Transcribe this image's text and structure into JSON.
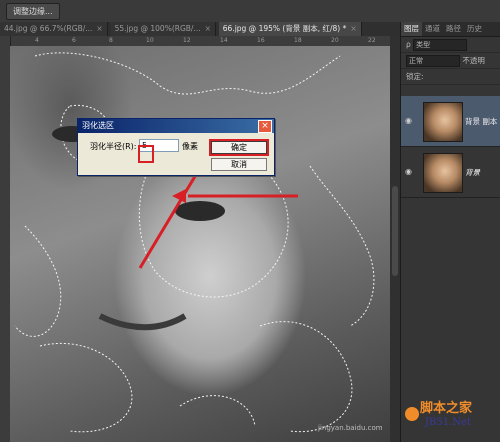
{
  "toolbar": {
    "refine_edge": "调整边缘..."
  },
  "tabs": [
    {
      "label": "44.jpg @ 66.7%(RGB/...",
      "close": "×"
    },
    {
      "label": "55.jpg @ 100%(RGB/...",
      "close": "×"
    },
    {
      "label": "66.jpg @ 195% (背景 副本, 红/8) *",
      "close": "×"
    }
  ],
  "ruler": {
    "ticks": [
      "4",
      "6",
      "8",
      "10",
      "12",
      "14",
      "16",
      "18",
      "20",
      "22"
    ]
  },
  "panel": {
    "tabs": [
      "图层",
      "通道",
      "路径",
      "历史"
    ],
    "kind_label": "类型",
    "blend_mode": "正常",
    "opacity_label": "不透明",
    "lock_label": "锁定:",
    "layers": [
      {
        "name": "背景 副本",
        "selected": true
      },
      {
        "name": "背景",
        "selected": false
      }
    ]
  },
  "dialog": {
    "title": "羽化选区",
    "radius_label": "羽化半径(R):",
    "radius_value": "5",
    "unit": "像素",
    "ok": "确定",
    "cancel": "取消"
  },
  "watermark": {
    "main": "脚本之家",
    "url": "JB51.Net",
    "faint": "jingyan.baidu.com"
  },
  "colors": {
    "accent": "#d81f26",
    "title_bar": "#0a246a",
    "selected_layer": "#4c5a6e"
  }
}
